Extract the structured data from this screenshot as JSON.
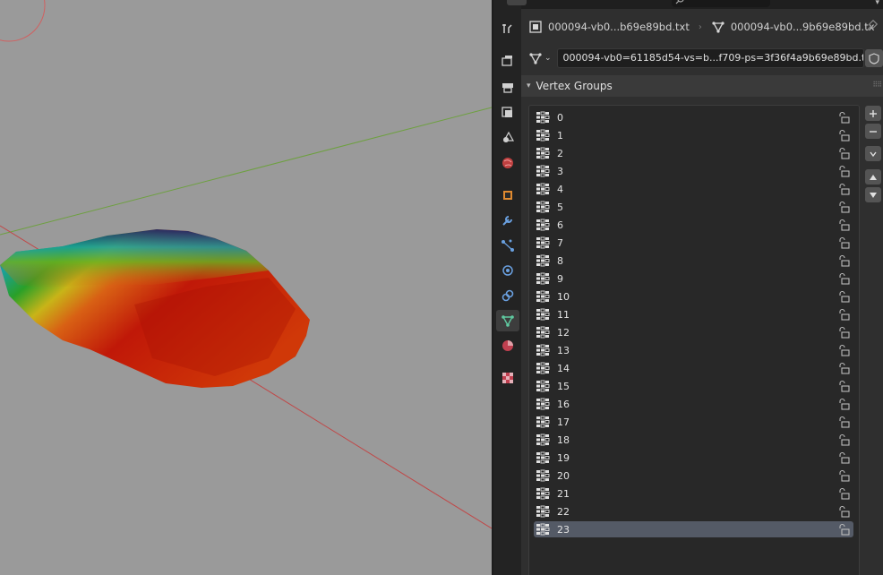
{
  "header": {
    "object_name": "000094-vb0...b69e89bd.txt",
    "mesh_name": "000094-vb0...9b69e89bd.tx"
  },
  "mesh_data": {
    "name": "000094-vb0=61185d54-vs=b...f709-ps=3f36f4a9b69e89bd.txt"
  },
  "panel": {
    "title": "Vertex Groups"
  },
  "vertex_groups": [
    {
      "name": "0"
    },
    {
      "name": "1"
    },
    {
      "name": "2"
    },
    {
      "name": "3"
    },
    {
      "name": "4"
    },
    {
      "name": "5"
    },
    {
      "name": "6"
    },
    {
      "name": "7"
    },
    {
      "name": "8"
    },
    {
      "name": "9"
    },
    {
      "name": "10"
    },
    {
      "name": "11"
    },
    {
      "name": "12"
    },
    {
      "name": "13"
    },
    {
      "name": "14"
    },
    {
      "name": "15"
    },
    {
      "name": "16"
    },
    {
      "name": "17"
    },
    {
      "name": "18"
    },
    {
      "name": "19"
    },
    {
      "name": "20"
    },
    {
      "name": "21"
    },
    {
      "name": "22"
    },
    {
      "name": "23",
      "selected": true
    }
  ],
  "tabs": [
    {
      "icon": "tool-icon"
    },
    {
      "icon": "render-icon"
    },
    {
      "icon": "output-icon"
    },
    {
      "icon": "view-layer-icon"
    },
    {
      "icon": "scene-icon"
    },
    {
      "icon": "world-icon"
    },
    {
      "icon": "object-icon"
    },
    {
      "icon": "modifier-icon"
    },
    {
      "icon": "particles-icon"
    },
    {
      "icon": "physics-icon"
    },
    {
      "icon": "constraints-icon"
    },
    {
      "icon": "mesh-data-icon",
      "active": true
    },
    {
      "icon": "material-icon"
    },
    {
      "icon": "texture-icon"
    }
  ],
  "colors": {
    "viewport_bg": "#9a9a9a",
    "panel_bg": "#303030",
    "selected_row": "#545a66",
    "active_tab_icon": "#5fc9a0",
    "axis_x": "#c04848",
    "axis_y": "#6ea040"
  }
}
